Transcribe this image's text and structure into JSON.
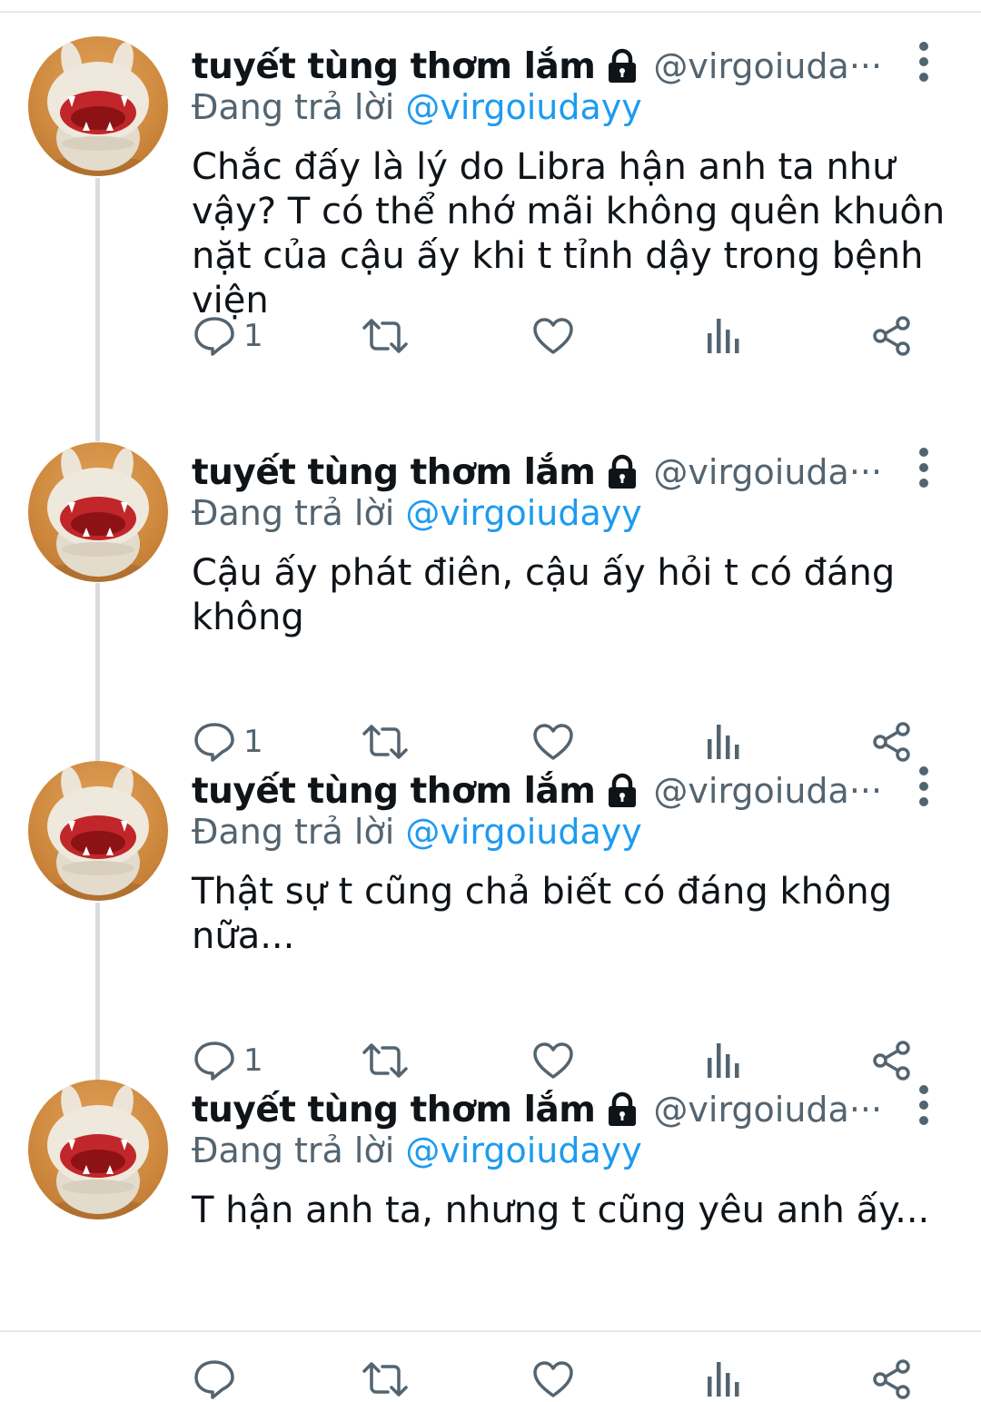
{
  "colors": {
    "accent": "#1d9bf0",
    "secondary_text": "#536471",
    "thread_line": "#d9dcdf"
  },
  "tweets": [
    {
      "name": "tuyết tùng thơm lắm",
      "protected_icon": "lock-icon",
      "handle": "@virgoiuda···",
      "reply_prefix": "Đang trả lời",
      "reply_to": "@virgoiudayy",
      "text": "Chắc đấy là lý do Libra hận anh ta như vậy? T có thể nhớ mãi không quên khuôn nặt của cậu ấy khi t tỉnh dậy trong bệnh viện",
      "reply_count": "1"
    },
    {
      "name": "tuyết tùng thơm lắm",
      "protected_icon": "lock-icon",
      "handle": "@virgoiuda···",
      "reply_prefix": "Đang trả lời",
      "reply_to": "@virgoiudayy",
      "text": "Cậu ấy phát điên, cậu ấy hỏi t có đáng không",
      "reply_count": "1"
    },
    {
      "name": "tuyết tùng thơm lắm",
      "protected_icon": "lock-icon",
      "handle": "@virgoiuda···",
      "reply_prefix": "Đang trả lời",
      "reply_to": "@virgoiudayy",
      "text": "Thật sự t cũng chả biết có đáng không nữa...",
      "reply_count": "1"
    },
    {
      "name": "tuyết tùng thơm lắm",
      "protected_icon": "lock-icon",
      "handle": "@virgoiuda···",
      "reply_prefix": "Đang trả lời",
      "reply_to": "@virgoiudayy",
      "text": "T hận anh ta, nhưng t cũng yêu anh ấy...",
      "reply_count": ""
    }
  ]
}
